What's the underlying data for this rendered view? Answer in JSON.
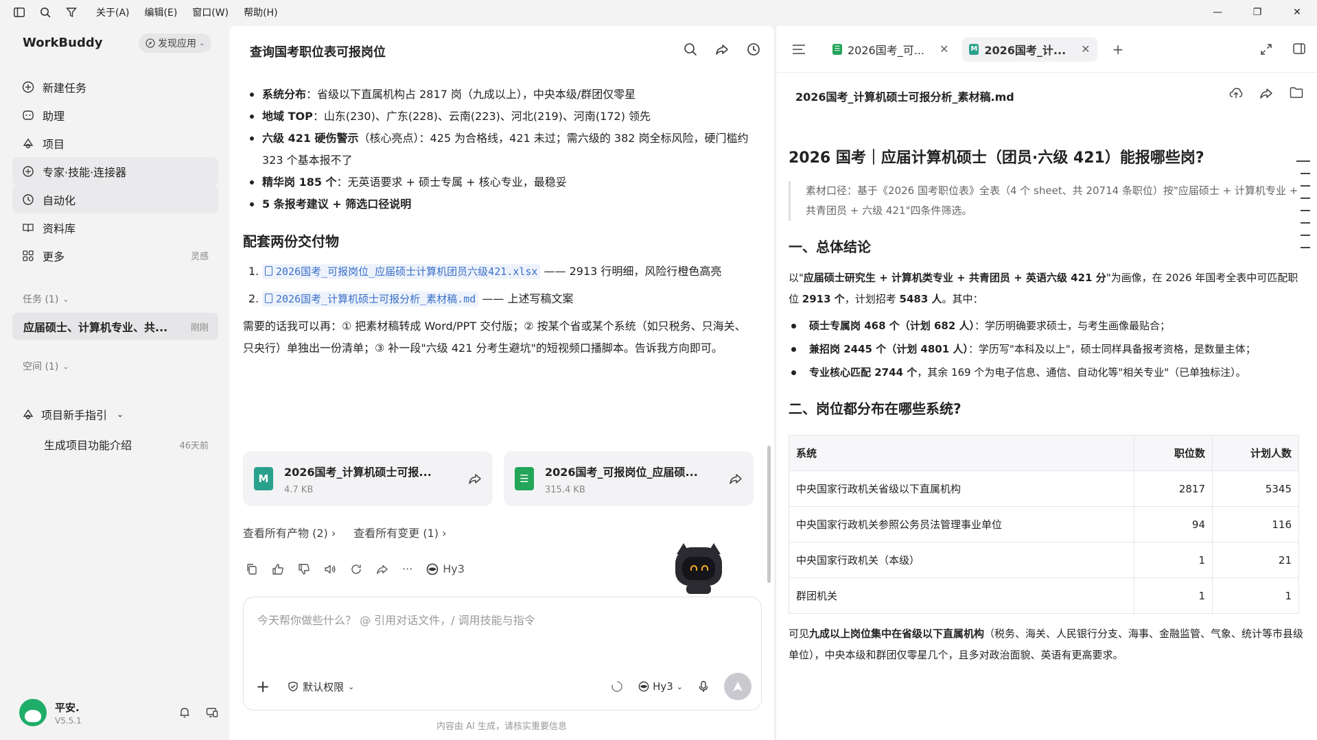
{
  "menubar": {
    "items": [
      "关于(A)",
      "编辑(E)",
      "窗口(W)",
      "帮助(H)"
    ]
  },
  "sidebar": {
    "brand": "WorkBuddy",
    "discover_label": "发现应用",
    "nav": [
      {
        "label": "新建任务",
        "icon": "plus-circle-icon"
      },
      {
        "label": "助理",
        "icon": "assistant-icon"
      },
      {
        "label": "项目",
        "icon": "project-icon"
      },
      {
        "label": "专家·技能·连接器",
        "icon": "expert-icon"
      },
      {
        "label": "自动化",
        "icon": "automation-icon"
      },
      {
        "label": "资料库",
        "icon": "library-icon"
      },
      {
        "label": "更多",
        "icon": "more-icon",
        "badge": "灵感"
      }
    ],
    "tasks_label": "任务 (1)",
    "task_item": {
      "label": "应届硕士、计算机专业、共...",
      "time": "刚刚"
    },
    "spaces_label": "空间 (1)",
    "project_guide": "项目新手指引",
    "project_sub": {
      "label": "生成项目功能介绍",
      "time": "46天前"
    },
    "user": {
      "name": "平安.",
      "version": "V5.5.1"
    }
  },
  "chat": {
    "title": "查询国考职位表可报岗位",
    "bullets": [
      {
        "bold": "系统分布",
        "text": "：省级以下直属机构占 2817 岗（九成以上），中央本级/群团仅零星"
      },
      {
        "bold": "地域 TOP",
        "text": "：山东(230)、广东(228)、云南(223)、河北(219)、河南(172) 领先"
      },
      {
        "bold": "六级 421 硬伤警示",
        "text": "（核心亮点）：425 为合格线，421 未过；需六级的 382 岗全标风险，硬门槛约 323 个基本报不了"
      },
      {
        "bold": "精华岗 185 个",
        "text": "：无英语要求 + 硕士专属 + 核心专业，最稳妥"
      },
      {
        "bold": "5 条报考建议 + 筛选口径说明",
        "text": ""
      }
    ],
    "deliverables_title": "配套两份交付物",
    "deliverables": [
      {
        "num": "1.",
        "file": "2026国考_可报岗位_应届硕士计算机团员六级421.xlsx",
        "desc": " —— 2913 行明细，风险行橙色高亮"
      },
      {
        "num": "2.",
        "file": "2026国考_计算机硕士可报分析_素材稿.md",
        "desc": " —— 上述写稿文案"
      }
    ],
    "followup": "需要的话我可以再：① 把素材稿转成 Word/PPT 交付版；② 按某个省或某个系统（如只税务、只海关、只央行）单独出一份清单；③ 补一段\"六级 421 分考生避坑\"的短视频口播脚本。告诉我方向即可。",
    "cards": [
      {
        "name": "2026国考_计算机硕士可报...",
        "size": "4.7 KB",
        "type_letter": "M"
      },
      {
        "name": "2026国考_可报岗位_应届硕...",
        "size": "315.4 KB",
        "type_letter": "☰"
      }
    ],
    "view_outputs": "查看所有产物 (2)",
    "view_changes": "查看所有变更 (1)",
    "model": "Hy3",
    "input_placeholder": "今天帮你做些什么？  @ 引用对话文件，/ 调用技能与指令",
    "permission": "默认权限",
    "model_select": "Hy3",
    "disclaimer": "内容由 AI 生成，请核实重要信息"
  },
  "doc": {
    "tabs": [
      {
        "label": "2026国考_可...",
        "type": "xlsx"
      },
      {
        "label": "2026国考_计...",
        "type": "md",
        "active": true
      }
    ],
    "filename": "2026国考_计算机硕士可报分析_素材稿.md",
    "h1": "2026 国考｜应届计算机硕士（团员·六级 421）能报哪些岗?",
    "quote": "素材口径：基于《2026 国考职位表》全表（4 个 sheet、共 20714 条职位）按\"应届硕士 + 计算机专业 + 共青团员 + 六级 421\"四条件筛选。",
    "h2_1": "一、总体结论",
    "summary_pre": "以\"",
    "summary_bold": "应届硕士研究生 + 计算机类专业 + 共青团员 + 英语六级 421 分",
    "summary_mid": "\"为画像，在 2026 年国考全表中可匹配职位 ",
    "summary_count": "2913 个",
    "summary_mid2": "，计划招考 ",
    "summary_plan": "5483 人",
    "summary_end": "。其中：",
    "points": [
      {
        "bold": "硕士专属岗 468 个（计划 682 人）",
        "text": "：学历明确要求硕士，与考生画像最贴合；"
      },
      {
        "bold": "兼招岗 2445 个（计划 4801 人）",
        "text": "：学历写\"本科及以上\"，硕士同样具备报考资格，是数量主体；"
      },
      {
        "bold": "专业核心匹配 2744 个",
        "text": "，其余 169 个为电子信息、通信、自动化等\"相关专业\"（已单独标注）。"
      }
    ],
    "h2_2": "二、岗位都分布在哪些系统?",
    "table": {
      "headers": [
        "系统",
        "职位数",
        "计划人数"
      ],
      "rows": [
        [
          "中央国家行政机关省级以下直属机构",
          "2817",
          "5345"
        ],
        [
          "中央国家行政机关参照公务员法管理事业单位",
          "94",
          "116"
        ],
        [
          "中央国家行政机关（本级）",
          "1",
          "21"
        ],
        [
          "群团机关",
          "1",
          "1"
        ]
      ]
    },
    "conclusion_pre": "可见",
    "conclusion_bold": "九成以上岗位集中在省级以下直属机构",
    "conclusion_text": "（税务、海关、人民银行分支、海事、金融监管、气象、统计等市县级单位），中央本级和群团仅零星几个，且多对政治面貌、英语有更高要求。"
  }
}
